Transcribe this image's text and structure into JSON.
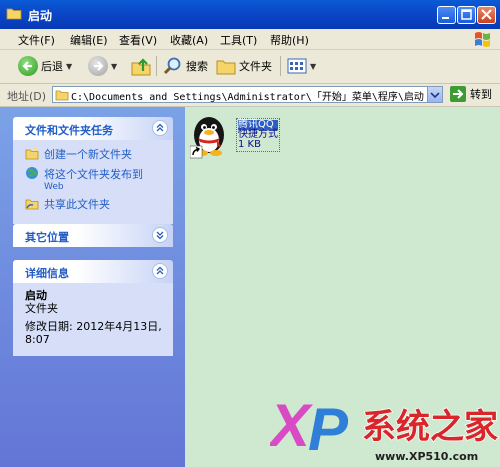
{
  "window": {
    "title": "启动"
  },
  "menubar": {
    "items": [
      "文件(F)",
      "编辑(E)",
      "查看(V)",
      "收藏(A)",
      "工具(T)",
      "帮助(H)"
    ]
  },
  "toolbar": {
    "back_label": "后退",
    "search_label": "搜索",
    "folders_label": "文件夹"
  },
  "addressbar": {
    "label": "地址(D)",
    "value": "C:\\Documents and Settings\\Administrator\\「开始」菜单\\程序\\启动",
    "go_label": "转到"
  },
  "taskpane": {
    "file_tasks": {
      "title": "文件和文件夹任务",
      "items": [
        {
          "label": "创建一个新文件夹",
          "sub": ""
        },
        {
          "label": "将这个文件夹发布到",
          "sub": "Web"
        },
        {
          "label": "共享此文件夹",
          "sub": ""
        }
      ]
    },
    "other_places": {
      "title": "其它位置"
    },
    "details": {
      "title": "详细信息",
      "name": "启动",
      "type": "文件夹",
      "modified_line1": "修改日期: 2012年4月13日,",
      "modified_line2": "8:07"
    }
  },
  "content": {
    "files": [
      {
        "name": "腾讯QQ",
        "type": "快捷方式",
        "size": "1 KB",
        "icon": "qq-penguin-icon"
      }
    ]
  },
  "watermark": {
    "text": "系统之家",
    "url": "www.XP510.com"
  },
  "colors": {
    "titlebar": "#0a47c8",
    "taskpane": "#7ba2e7",
    "content_bg": "#cfe8d0",
    "link": "#215dc6"
  }
}
